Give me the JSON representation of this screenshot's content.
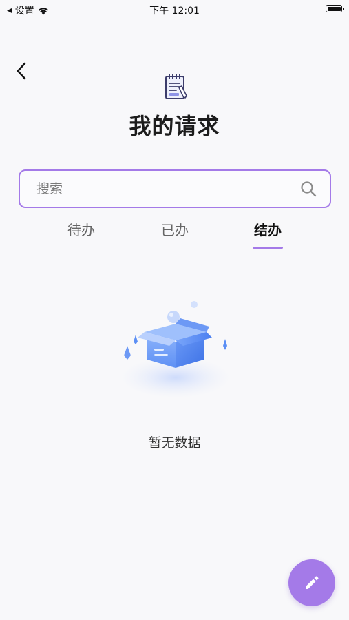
{
  "status_bar": {
    "carrier": "设置",
    "time": "下午 12:01"
  },
  "header": {
    "title": "我的请求",
    "icon": "notepad-icon"
  },
  "search": {
    "placeholder": "搜索",
    "value": ""
  },
  "tabs": [
    {
      "label": "待办",
      "active": false
    },
    {
      "label": "已办",
      "active": false
    },
    {
      "label": "结办",
      "active": true
    }
  ],
  "empty_state": {
    "message": "暂无数据",
    "icon": "empty-box-icon"
  },
  "fab": {
    "icon": "pencil-icon"
  },
  "colors": {
    "accent": "#a47ae8",
    "background": "#f8f8fa",
    "illustration_blue": "#5b8ff5"
  }
}
